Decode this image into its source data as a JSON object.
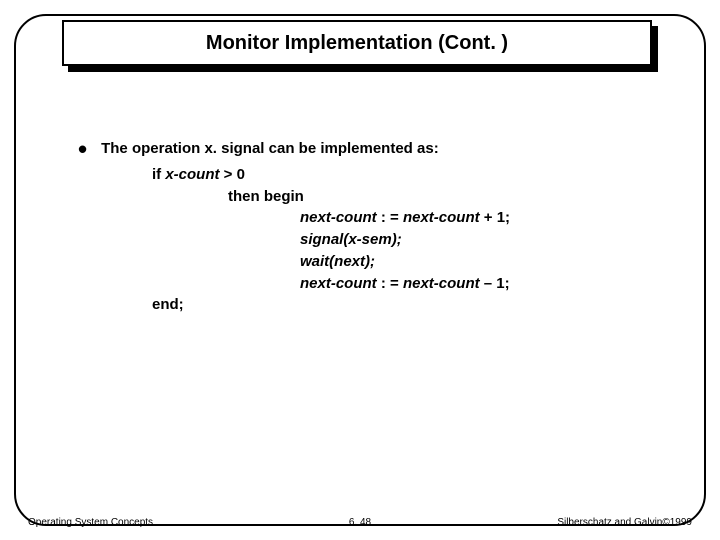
{
  "title": "Monitor Implementation (Cont. )",
  "bullet": "The operation x. signal can be implemented as:",
  "code": {
    "if_kw": "if",
    "if_cond": " x-count ",
    "if_rest": "> 0",
    "then_kw": "then begin",
    "line1_a": "next-count",
    "line1_b": " : = ",
    "line1_c": "next-count",
    "line1_d": " + 1;",
    "line2": "signal(x-sem);",
    "line3": "wait(next);",
    "line4_a": "next-count",
    "line4_b": " : = ",
    "line4_c": "next-count",
    "line4_d": " – 1;",
    "end_kw": "end",
    "end_semi": ";"
  },
  "footer": {
    "left": "Operating System Concepts",
    "center": "6. 48",
    "right_a": "Silberschatz and Galvin",
    "right_b": "1999",
    "copy": "©"
  }
}
